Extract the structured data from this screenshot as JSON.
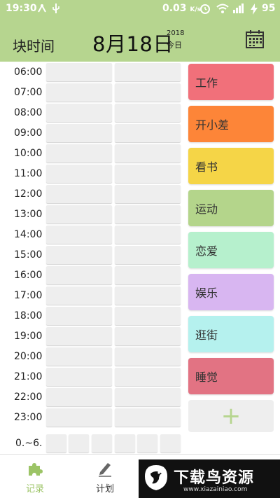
{
  "status_bar": {
    "time": "19:30",
    "net_speed": "0.03",
    "net_unit": "K/s",
    "battery": "95"
  },
  "header": {
    "app_title": "块时间",
    "date": "8月18日",
    "year": "2018",
    "today": "今日"
  },
  "timeline": {
    "hours": [
      "06:00",
      "07:00",
      "08:00",
      "09:00",
      "10:00",
      "11:00",
      "12:00",
      "13:00",
      "14:00",
      "15:00",
      "16:00",
      "17:00",
      "18:00",
      "19:00",
      "20:00",
      "21:00",
      "22:00",
      "23:00"
    ],
    "night_label": "0.~6."
  },
  "categories": [
    {
      "label": "工作",
      "color": "#f1707a"
    },
    {
      "label": "开小差",
      "color": "#fd8538"
    },
    {
      "label": "看书",
      "color": "#f5d547"
    },
    {
      "label": "运动",
      "color": "#b4d58b"
    },
    {
      "label": "恋爱",
      "color": "#b6f0cd"
    },
    {
      "label": "娱乐",
      "color": "#d8b6f1"
    },
    {
      "label": "逛街",
      "color": "#b5f1ee"
    },
    {
      "label": "睡觉",
      "color": "#e27383"
    }
  ],
  "add_label": "+",
  "nav": {
    "record": "记录",
    "plan": "计划"
  },
  "watermark": {
    "title": "下载鸟资源",
    "url": "www.xiazainiao.com"
  },
  "colors": {
    "accent": "#b6d58f",
    "cell": "#eeeeee",
    "active_nav": "#9cc466"
  }
}
